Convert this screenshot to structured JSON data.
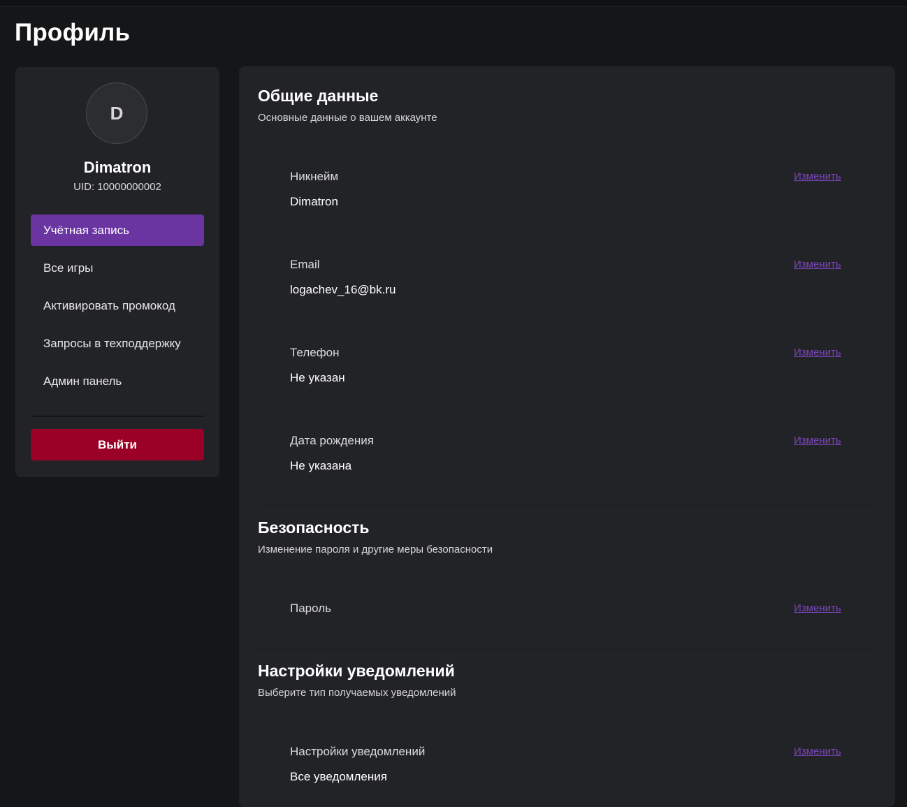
{
  "page": {
    "title": "Профиль"
  },
  "sidebar": {
    "avatar_initial": "D",
    "user_name": "Dimatron",
    "uid_label": "UID:",
    "uid_value": "10000000002",
    "nav": [
      {
        "label": "Учётная запись",
        "active": true
      },
      {
        "label": "Все игры",
        "active": false
      },
      {
        "label": "Активировать промокод",
        "active": false
      },
      {
        "label": "Запросы в техподдержку",
        "active": false
      },
      {
        "label": "Админ панель",
        "active": false
      }
    ],
    "logout_label": "Выйти"
  },
  "sections": {
    "general": {
      "title": "Общие данные",
      "subtitle": "Основные данные о вашем аккаунте",
      "fields": [
        {
          "label": "Никнейм",
          "value": "Dimatron",
          "action": "Изменить"
        },
        {
          "label": "Email",
          "value": "logachev_16@bk.ru",
          "action": "Изменить"
        },
        {
          "label": "Телефон",
          "value": "Не указан",
          "action": "Изменить"
        },
        {
          "label": "Дата рождения",
          "value": "Не указана",
          "action": "Изменить"
        }
      ]
    },
    "security": {
      "title": "Безопасность",
      "subtitle": "Изменение пароля и другие меры безопасности",
      "fields": [
        {
          "label": "Пароль",
          "action": "Изменить"
        }
      ]
    },
    "notifications": {
      "title": "Настройки уведомлений",
      "subtitle": "Выберите тип получаемых уведомлений",
      "fields": [
        {
          "label": "Настройки уведомлений",
          "value": "Все уведомления",
          "action": "Изменить"
        }
      ]
    }
  },
  "colors": {
    "background": "#151618",
    "panel": "#222327",
    "accent": "#6a35a1",
    "link": "#7a45b8",
    "danger": "#9b0026"
  }
}
